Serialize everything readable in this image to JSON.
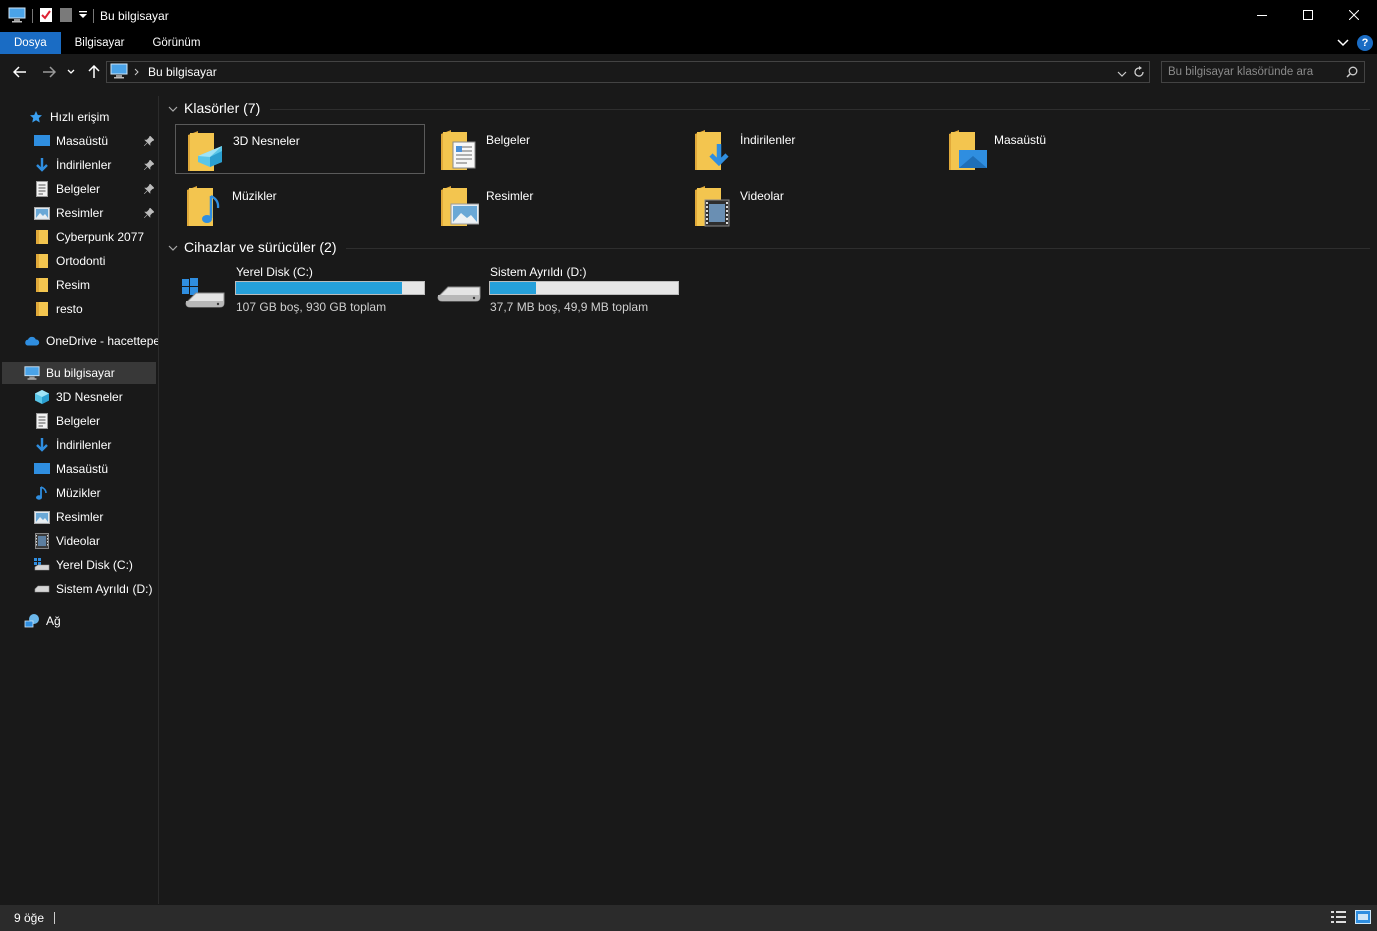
{
  "window": {
    "title": "Bu bilgisayar"
  },
  "ribbon": {
    "tabs": [
      {
        "label": "Dosya",
        "active": true
      },
      {
        "label": "Bilgisayar",
        "active": false
      },
      {
        "label": "Görünüm",
        "active": false
      }
    ],
    "help_label": "?"
  },
  "address": {
    "crumb": "Bu bilgisayar",
    "search_placeholder": "Bu bilgisayar klasöründe ara"
  },
  "sidebar": {
    "quick_access": "Hızlı erişim",
    "quick_items": [
      {
        "label": "Masaüstü",
        "icon": "desktop-icon",
        "pinned": true
      },
      {
        "label": "İndirilenler",
        "icon": "download-icon",
        "pinned": true
      },
      {
        "label": "Belgeler",
        "icon": "document-icon",
        "pinned": true
      },
      {
        "label": "Resimler",
        "icon": "picture-icon",
        "pinned": true
      },
      {
        "label": "Cyberpunk 2077",
        "icon": "folder-icon",
        "pinned": false
      },
      {
        "label": "Ortodonti",
        "icon": "folder-icon",
        "pinned": false
      },
      {
        "label": "Resim",
        "icon": "folder-icon",
        "pinned": false
      },
      {
        "label": "resto",
        "icon": "folder-icon",
        "pinned": false
      }
    ],
    "onedrive": "OneDrive - hacettepe",
    "this_pc": "Bu bilgisayar",
    "pc_items": [
      {
        "label": "3D Nesneler",
        "icon": "3d-objects-icon"
      },
      {
        "label": "Belgeler",
        "icon": "document-icon"
      },
      {
        "label": "İndirilenler",
        "icon": "download-icon"
      },
      {
        "label": "Masaüstü",
        "icon": "desktop-icon"
      },
      {
        "label": "Müzikler",
        "icon": "music-icon"
      },
      {
        "label": "Resimler",
        "icon": "picture-icon"
      },
      {
        "label": "Videolar",
        "icon": "video-icon"
      },
      {
        "label": "Yerel Disk (C:)",
        "icon": "drive-icon"
      },
      {
        "label": "Sistem Ayrıldı (D:)",
        "icon": "drive-icon"
      }
    ],
    "network": "Ağ"
  },
  "content": {
    "folders_header": "Klasörler (7)",
    "folders": [
      {
        "label": "3D Nesneler",
        "icon": "3d-objects-folder-icon"
      },
      {
        "label": "Belgeler",
        "icon": "documents-folder-icon"
      },
      {
        "label": "İndirilenler",
        "icon": "downloads-folder-icon"
      },
      {
        "label": "Masaüstü",
        "icon": "desktop-folder-icon"
      },
      {
        "label": "Müzikler",
        "icon": "music-folder-icon"
      },
      {
        "label": "Resimler",
        "icon": "pictures-folder-icon"
      },
      {
        "label": "Videolar",
        "icon": "videos-folder-icon"
      }
    ],
    "devices_header": "Cihazlar ve sürücüler (2)",
    "drives": [
      {
        "label": "Yerel Disk (C:)",
        "detail": "107 GB boş, 930 GB toplam",
        "used_fraction": 0.885,
        "windows": true
      },
      {
        "label": "Sistem Ayrıldı (D:)",
        "detail": "37,7 MB boş, 49,9 MB toplam",
        "used_fraction": 0.245,
        "windows": false
      }
    ]
  },
  "status": {
    "items_count": "9 öğe"
  },
  "colors": {
    "accent": "#1a6cc4",
    "background": "#191919",
    "drive_bar": "#26a0da",
    "folder": "#f3c54f"
  }
}
